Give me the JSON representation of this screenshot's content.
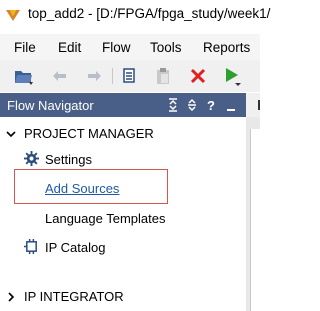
{
  "window": {
    "title": "top_add2 - [D:/FPGA/fpga_study/week1/"
  },
  "menu": {
    "items": [
      "File",
      "Edit",
      "Flow",
      "Tools",
      "Reports"
    ]
  },
  "toolbar": {
    "icons": [
      "open-folder-icon",
      "undo-icon",
      "redo-icon",
      "copy-icon",
      "paste-icon",
      "close-x-icon",
      "run-icon"
    ]
  },
  "flow_navigator": {
    "title": "Flow Navigator",
    "header_icons": [
      "collapse-all-icon",
      "expand-all-icon",
      "help-icon",
      "minimize-icon"
    ],
    "sections": [
      {
        "label": "PROJECT MANAGER",
        "expanded": true,
        "items": [
          {
            "label": "Settings",
            "icon": "gear-icon",
            "style": "normal"
          },
          {
            "label": "Add Sources",
            "icon": null,
            "style": "link",
            "highlighted": true
          },
          {
            "label": "Language Templates",
            "icon": null,
            "style": "normal"
          },
          {
            "label": "IP Catalog",
            "icon": "ip-catalog-icon",
            "style": "normal"
          }
        ]
      },
      {
        "label": "IP INTEGRATOR",
        "expanded": false,
        "items": []
      }
    ]
  },
  "colors": {
    "nav_header_bg": "#4a5f87",
    "link": "#1f5aa6",
    "highlight_border": "#d9534f",
    "run_green": "#2e9e2e",
    "stop_red": "#e02020"
  }
}
